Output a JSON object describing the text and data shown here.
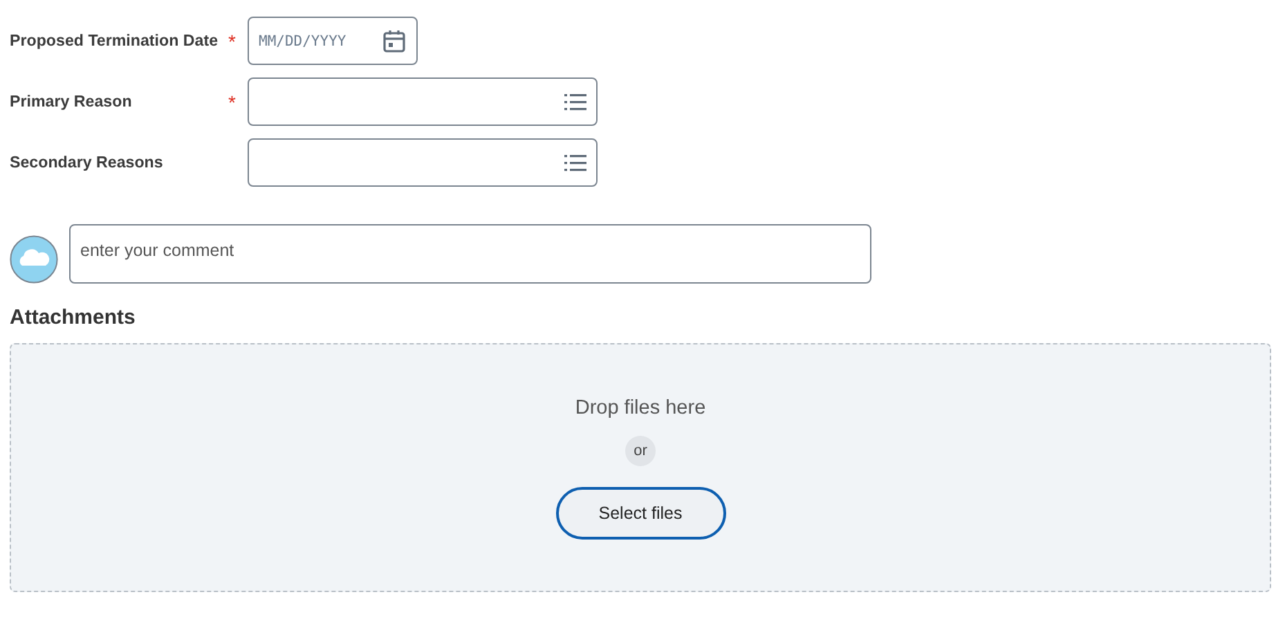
{
  "fields": [
    {
      "label": "Proposed Termination Date",
      "required": true,
      "kind": "date",
      "placeholder": "MM/DD/YYYY"
    },
    {
      "label": "Primary Reason",
      "required": true,
      "kind": "select"
    },
    {
      "label": "Secondary Reasons",
      "required": false,
      "kind": "select"
    }
  ],
  "required_mark": "*",
  "comment": {
    "placeholder": "enter your comment"
  },
  "attachments": {
    "title": "Attachments",
    "drop_text": "Drop files here",
    "or_text": "or",
    "button": "Select files"
  }
}
